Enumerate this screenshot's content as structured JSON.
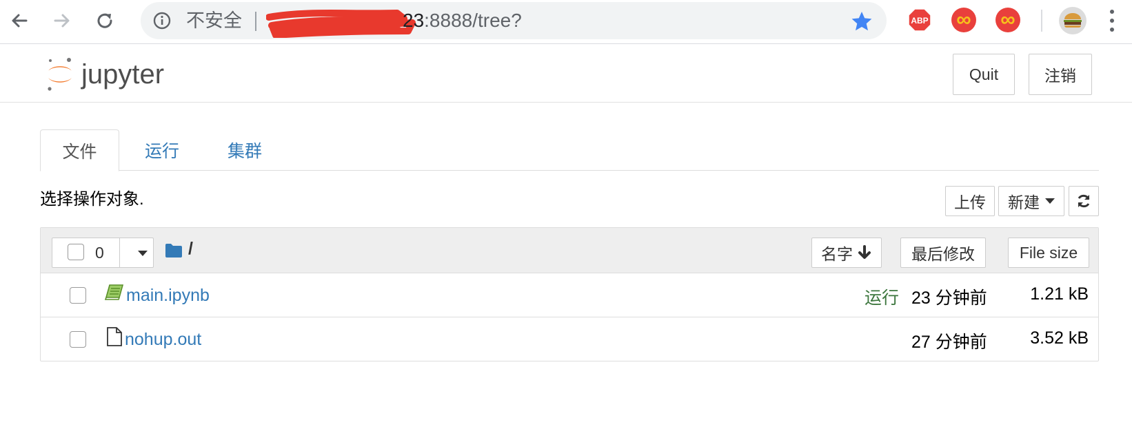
{
  "browser": {
    "insecure_label": "不安全",
    "url_host_visible": "23",
    "url_rest": ":8888/tree?",
    "colors": {
      "star": "#4285f4",
      "abp": "#e9403c"
    },
    "extensions": [
      {
        "name": "abp-icon",
        "label": "ABP"
      },
      {
        "name": "infinity-icon",
        "label": "∞"
      },
      {
        "name": "infinity-icon",
        "label": "∞"
      }
    ]
  },
  "header": {
    "logo_text": "jupyter",
    "quit_label": "Quit",
    "logout_label": "注销",
    "colors": {
      "logo_orange": "#f37626",
      "logo_gray": "#767677"
    }
  },
  "tabs": [
    {
      "label": "文件",
      "active": true
    },
    {
      "label": "运行",
      "active": false
    },
    {
      "label": "集群",
      "active": false
    }
  ],
  "toolbar": {
    "select_hint": "选择操作对象.",
    "upload_label": "上传",
    "new_label": "新建",
    "refresh_icon": "refresh-icon"
  },
  "list": {
    "selected_count": "0",
    "breadcrumb": "/",
    "sort_name_label": "名字",
    "sort_modified_label": "最后修改",
    "sort_size_label": "File size",
    "rows": [
      {
        "name": "main.ipynb",
        "icon": "notebook-icon",
        "status": "运行",
        "modified": "23 分钟前",
        "size": "1.21 kB"
      },
      {
        "name": "nohup.out",
        "icon": "file-icon",
        "status": "",
        "modified": "27 分钟前",
        "size": "3.52 kB"
      }
    ]
  }
}
